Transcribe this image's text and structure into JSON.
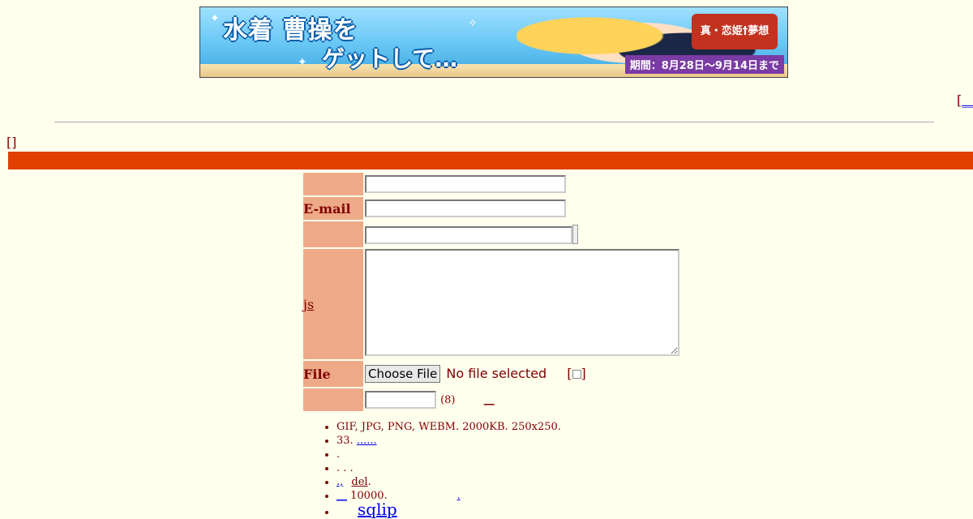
{
  "banner": {
    "headline_1": "水着 曹操を",
    "headline_2": "ゲットして…",
    "logo_text": "真・恋姫†夢想",
    "period_text": "期間：8月28日〜9月14日まで"
  },
  "corner_link": {
    "bracket": "[",
    "link": "__"
  },
  "top_bracket": "[]",
  "form": {
    "name_label": "",
    "email_label": "E-mail",
    "subject_label": "",
    "comment_label": "js",
    "file_label": "File",
    "file_button": "Choose File",
    "file_status": "No file selected",
    "file_option_open": "[",
    "file_option_close": "]",
    "password_label": "",
    "password_hint": "(8)",
    "password_link": "__"
  },
  "rules": [
    {
      "text": "GIF, JPG, PNG, WEBM. 2000KB. 250x250.",
      "link": ""
    },
    {
      "text": "33. ",
      "link": "......"
    },
    {
      "text": ".",
      "link": ""
    },
    {
      "text": ". . .",
      "link": ""
    },
    {
      "text": "",
      "link": ".,",
      "extra_link": "del",
      "suffix": "."
    },
    {
      "text": "",
      "link": "__",
      "suffix": " 10000.",
      "trailing_link": "."
    },
    {
      "text": "",
      "link": "",
      "big_link": "sqlip"
    }
  ]
}
